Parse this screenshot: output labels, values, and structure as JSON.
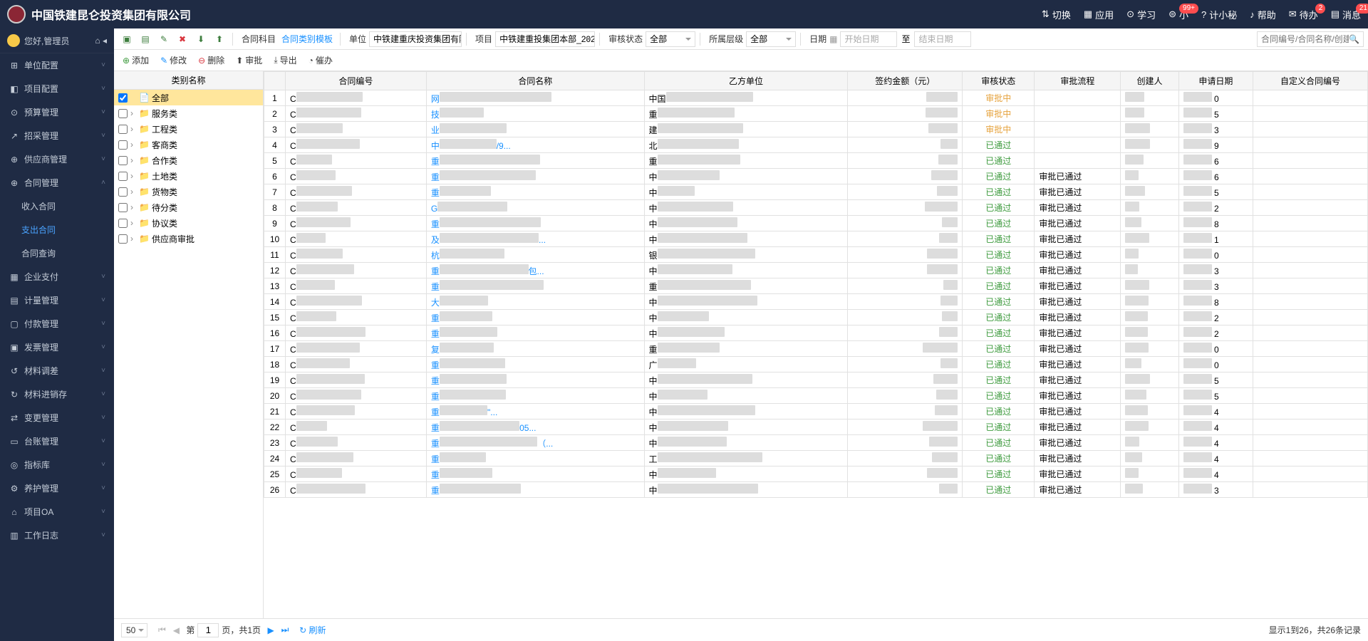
{
  "header": {
    "company": "中国铁建昆仑投资集团有限公司",
    "nav": {
      "switch": "切换",
      "apps": "应用",
      "study": "学习",
      "xiao": "小",
      "xiao_badge": "99+",
      "jxm": "计小秘",
      "help": "帮助",
      "todo": "待办",
      "todo_badge": "2",
      "message": "消息",
      "message_badge": "21"
    }
  },
  "sidebar": {
    "greeting": "您好,管理员",
    "items": [
      {
        "icon": "⊞",
        "label": "单位配置",
        "chev": true
      },
      {
        "icon": "◧",
        "label": "项目配置",
        "chev": true
      },
      {
        "icon": "⊙",
        "label": "预算管理",
        "chev": true
      },
      {
        "icon": "↗",
        "label": "招采管理",
        "chev": true
      },
      {
        "icon": "⊕",
        "label": "供应商管理",
        "chev": true
      },
      {
        "icon": "⊕",
        "label": "合同管理",
        "chev": true,
        "open": true,
        "subs": [
          {
            "label": "收入合同"
          },
          {
            "label": "支出合同",
            "active": true
          },
          {
            "label": "合同查询"
          }
        ]
      },
      {
        "icon": "▦",
        "label": "企业支付",
        "chev": true
      },
      {
        "icon": "▤",
        "label": "计量管理",
        "chev": true
      },
      {
        "icon": "▢",
        "label": "付款管理",
        "chev": true
      },
      {
        "icon": "▣",
        "label": "发票管理",
        "chev": true
      },
      {
        "icon": "↺",
        "label": "材料调差",
        "chev": true
      },
      {
        "icon": "↻",
        "label": "材料进销存",
        "chev": true
      },
      {
        "icon": "⇄",
        "label": "变更管理",
        "chev": true
      },
      {
        "icon": "▭",
        "label": "台账管理",
        "chev": true
      },
      {
        "icon": "◎",
        "label": "指标库",
        "chev": true
      },
      {
        "icon": "⚙",
        "label": "养护管理",
        "chev": true
      },
      {
        "icon": "⌂",
        "label": "项目OA",
        "chev": true
      },
      {
        "icon": "▥",
        "label": "工作日志",
        "chev": true
      }
    ]
  },
  "filter": {
    "subject": {
      "label": "合同科目",
      "tab1": "合同类别模板"
    },
    "unit": {
      "label": "单位",
      "value": "中铁建重庆投资集团有限"
    },
    "project": {
      "label": "项目",
      "value": "中铁建重投集团本部_202"
    },
    "audit": {
      "label": "审核状态",
      "value": "全部"
    },
    "level": {
      "label": "所属层级",
      "value": "全部"
    },
    "date": {
      "label": "日期",
      "start": "开始日期",
      "range": "至",
      "end": "结束日期"
    },
    "search_ph": "合同编号/合同名称/创建人"
  },
  "toolbar": {
    "add": "添加",
    "edit": "修改",
    "del": "删除",
    "approve": "审批",
    "export": "导出",
    "urge": "催办"
  },
  "tree": {
    "header": "类别名称",
    "nodes": [
      {
        "label": "全部",
        "selected": true,
        "root": true
      },
      {
        "label": "服务类"
      },
      {
        "label": "工程类"
      },
      {
        "label": "客商类"
      },
      {
        "label": "合作类"
      },
      {
        "label": "土地类"
      },
      {
        "label": "货物类"
      },
      {
        "label": "待分类"
      },
      {
        "label": "协议类"
      },
      {
        "label": "供应商审批"
      }
    ]
  },
  "table": {
    "cols": [
      "",
      "合同编号",
      "合同名称",
      "乙方单位",
      "签约金额（元）",
      "审核状态",
      "审批流程",
      "创建人",
      "申请日期",
      "自定义合同编号"
    ],
    "rows": [
      {
        "n": 1,
        "code": "C",
        "name": "网",
        "party": "中国",
        "st": "审批中",
        "stc": "p",
        "flow": "",
        "cr": "",
        "dt": "",
        "tail": "0"
      },
      {
        "n": 2,
        "code": "C",
        "name": "技",
        "party": "重",
        "st": "审批中",
        "stc": "p",
        "flow": "",
        "cr": "",
        "dt": "",
        "tail": "5"
      },
      {
        "n": 3,
        "code": "C",
        "name": "业",
        "party": "建",
        "st": "审批中",
        "stc": "p",
        "flow": "",
        "cr": "",
        "dt": "",
        "tail": "3"
      },
      {
        "n": 4,
        "code": "C",
        "name": "中",
        "nt": "/9...",
        "party": "北",
        "st": "已通过",
        "stc": "a",
        "flow": "",
        "cr": "",
        "dt": "",
        "tail": "9"
      },
      {
        "n": 5,
        "code": "C",
        "name": "重",
        "party": "重",
        "st": "已通过",
        "stc": "a",
        "flow": "",
        "cr": "",
        "dt": "",
        "tail": "6"
      },
      {
        "n": 6,
        "code": "C",
        "name": "重",
        "party": "中",
        "st": "已通过",
        "stc": "a",
        "flow": "审批已通过",
        "cr": "",
        "dt": "",
        "tail": "6"
      },
      {
        "n": 7,
        "code": "C",
        "name": "重",
        "party": "中",
        "st": "已通过",
        "stc": "a",
        "flow": "审批已通过",
        "cr": "",
        "dt": "",
        "tail": "5"
      },
      {
        "n": 8,
        "code": "C",
        "name": "G",
        "party": "中",
        "st": "已通过",
        "stc": "a",
        "flow": "审批已通过",
        "cr": "",
        "dt": "",
        "tail": "2"
      },
      {
        "n": 9,
        "code": "C",
        "name": "重",
        "party": "中",
        "st": "已通过",
        "stc": "a",
        "flow": "审批已通过",
        "cr": "",
        "dt": "",
        "tail": "8"
      },
      {
        "n": 10,
        "code": "C",
        "name": "及",
        "nt": "...",
        "party": "中",
        "st": "已通过",
        "stc": "a",
        "flow": "审批已通过",
        "cr": "",
        "dt": "",
        "tail": "1"
      },
      {
        "n": 11,
        "code": "C",
        "name": "杭",
        "party": "银",
        "st": "已通过",
        "stc": "a",
        "flow": "审批已通过",
        "cr": "",
        "dt": "",
        "tail": "0"
      },
      {
        "n": 12,
        "code": "C",
        "name": "重",
        "nt": "包...",
        "party": "中",
        "st": "已通过",
        "stc": "a",
        "flow": "审批已通过",
        "cr": "",
        "dt": "",
        "tail": "3"
      },
      {
        "n": 13,
        "code": "C",
        "name": "重",
        "party": "重",
        "st": "已通过",
        "stc": "a",
        "flow": "审批已通过",
        "cr": "",
        "dt": "",
        "tail": "3"
      },
      {
        "n": 14,
        "code": "C",
        "name": "大",
        "party": "中",
        "st": "已通过",
        "stc": "a",
        "flow": "审批已通过",
        "cr": "",
        "dt": "",
        "tail": "8"
      },
      {
        "n": 15,
        "code": "C",
        "name": "重",
        "party": "中",
        "st": "已通过",
        "stc": "a",
        "flow": "审批已通过",
        "cr": "",
        "dt": "",
        "tail": "2"
      },
      {
        "n": 16,
        "code": "C",
        "name": "重",
        "party": "中",
        "st": "已通过",
        "stc": "a",
        "flow": "审批已通过",
        "cr": "",
        "dt": "",
        "tail": "2"
      },
      {
        "n": 17,
        "code": "C",
        "name": "复",
        "party": "重",
        "st": "已通过",
        "stc": "a",
        "flow": "审批已通过",
        "cr": "",
        "dt": "",
        "tail": "0"
      },
      {
        "n": 18,
        "code": "C",
        "name": "重",
        "party": "广",
        "st": "已通过",
        "stc": "a",
        "flow": "审批已通过",
        "cr": "",
        "dt": "",
        "tail": "0"
      },
      {
        "n": 19,
        "code": "C",
        "name": "重",
        "party": "中",
        "st": "已通过",
        "stc": "a",
        "flow": "审批已通过",
        "cr": "",
        "dt": "",
        "tail": "5"
      },
      {
        "n": 20,
        "code": "C",
        "name": "重",
        "party": "中",
        "st": "已通过",
        "stc": "a",
        "flow": "审批已通过",
        "cr": "",
        "dt": "",
        "tail": "5"
      },
      {
        "n": 21,
        "code": "C",
        "name": "重",
        "nt": "\"...",
        "party": "中",
        "st": "已通过",
        "stc": "a",
        "flow": "审批已通过",
        "cr": "",
        "dt": "",
        "tail": "4"
      },
      {
        "n": 22,
        "code": "C",
        "name": "重",
        "nt": "05...",
        "party": "中",
        "st": "已通过",
        "stc": "a",
        "flow": "审批已通过",
        "cr": "",
        "dt": "",
        "tail": "4"
      },
      {
        "n": 23,
        "code": "C",
        "name": "重",
        "nt": "（...",
        "party": "中",
        "st": "已通过",
        "stc": "a",
        "flow": "审批已通过",
        "cr": "",
        "dt": "",
        "tail": "4"
      },
      {
        "n": 24,
        "code": "C",
        "name": "重",
        "party": "工",
        "st": "已通过",
        "stc": "a",
        "flow": "审批已通过",
        "cr": "",
        "dt": "",
        "tail": "4"
      },
      {
        "n": 25,
        "code": "C",
        "name": "重",
        "party": "中",
        "st": "已通过",
        "stc": "a",
        "flow": "审批已通过",
        "cr": "",
        "dt": "",
        "tail": "4"
      },
      {
        "n": 26,
        "code": "C",
        "name": "重",
        "party": "中",
        "st": "已通过",
        "stc": "a",
        "flow": "审批已通过",
        "cr": "",
        "dt": "",
        "tail": "3"
      }
    ]
  },
  "footer": {
    "page_size": "50",
    "page_label_prefix": "第",
    "page_num": "1",
    "page_label_suffix": "页，共1页",
    "refresh": "刷新",
    "summary": "显示1到26，共26条记录"
  }
}
